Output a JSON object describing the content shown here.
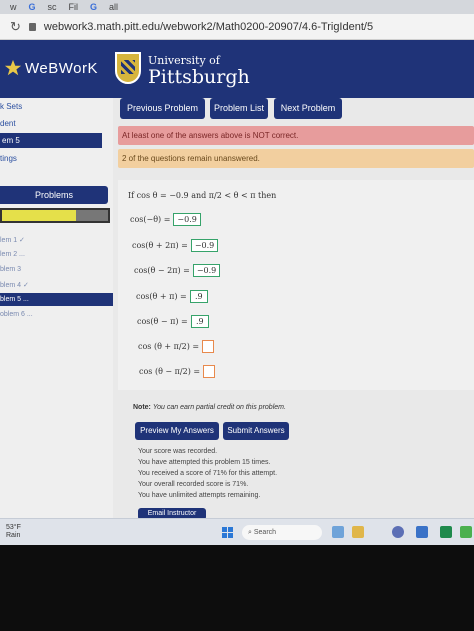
{
  "browser": {
    "tabs": [
      "w",
      "G",
      "sc",
      "Fil",
      "G",
      "all"
    ],
    "url": "webwork3.math.pitt.edu/webwork2/Math0200-20907/4.6-TrigIdent/5"
  },
  "header": {
    "logo_text": "WeBWorK",
    "university_top": "University of",
    "university_name": "Pittsburgh"
  },
  "sidebar": {
    "links": [
      "k Sets",
      "dent"
    ],
    "active_link": "em 5",
    "other_link": "tings",
    "problems_label": "Problems",
    "progress": {
      "correct_fraction": 0.0,
      "partial_fraction": 0.7
    },
    "problem_items": [
      "lem 1 ✓",
      "lem 2 ...",
      "blem 3",
      "blem 4 ✓"
    ],
    "active_problem": "blem 5 ...",
    "problem_after": "oblem 6 ..."
  },
  "nav": {
    "previous": "Previous Problem",
    "list": "Problem List",
    "next": "Next Problem"
  },
  "alerts": {
    "incorrect": "At least one of the answers above is NOT correct.",
    "unanswered": "2 of the questions remain unanswered."
  },
  "problem": {
    "intro_if": "If",
    "intro_condition": "cos θ = −0.9 and",
    "intro_range": "π/2 < θ < π",
    "intro_then": "then",
    "questions": [
      {
        "expr": "cos(−θ) =",
        "answer": "−0.9"
      },
      {
        "expr": "cos(θ + 2π) =",
        "answer": "−0.9"
      },
      {
        "expr": "cos(θ − 2π) =",
        "answer": "−0.9"
      },
      {
        "expr": "cos(θ + π) =",
        "answer": ".9"
      },
      {
        "expr": "cos(θ − π) =",
        "answer": ".9"
      },
      {
        "expr": "cos (θ + π/2) =",
        "answer": ""
      },
      {
        "expr": "cos (θ − π/2) =",
        "answer": ""
      }
    ]
  },
  "note": {
    "label": "Note:",
    "text": "You can earn partial credit on this problem."
  },
  "actions": {
    "preview": "Preview My Answers",
    "submit": "Submit Answers",
    "email": "Email Instructor"
  },
  "status": [
    "Your score was recorded.",
    "You have attempted this problem 15 times.",
    "You received a score of 71% for this attempt.",
    "Your overall recorded score is 71%.",
    "You have unlimited attempts remaining."
  ],
  "taskbar": {
    "temperature": "53°F",
    "condition": "Rain",
    "search_placeholder": "Search"
  }
}
